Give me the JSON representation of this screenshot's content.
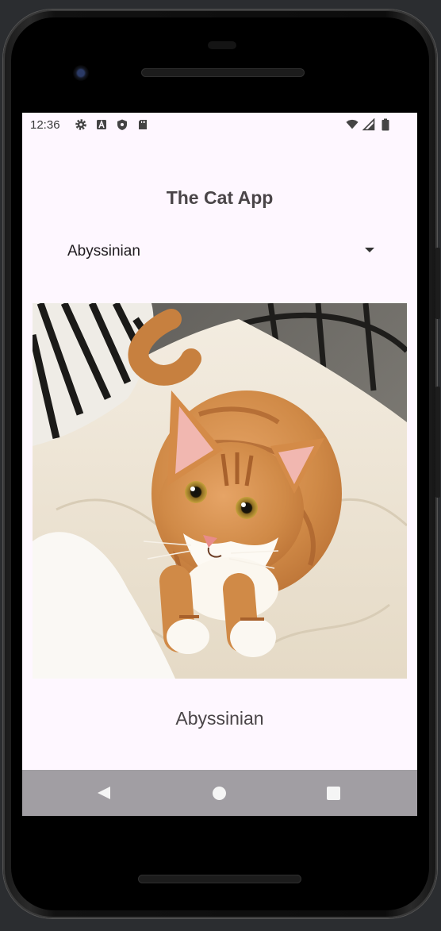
{
  "status_bar": {
    "time": "12:36",
    "left_icons": [
      "gear-icon",
      "font-a-icon",
      "shield-icon",
      "sd-card-icon"
    ],
    "right_icons": [
      "wifi-icon",
      "cell-signal-icon",
      "battery-icon"
    ]
  },
  "app": {
    "title": "The Cat App",
    "breed_select": {
      "selected": "Abyssinian"
    },
    "cat_image": {
      "icon": "cat-photo"
    },
    "breed_name": "Abyssinian"
  },
  "nav_bar": {
    "buttons": [
      "back-icon",
      "home-icon",
      "recents-icon"
    ]
  },
  "colors": {
    "screen_background": "#fef7ff",
    "nav_bar_background": "#a19ea3",
    "title_text": "#4a4548"
  }
}
